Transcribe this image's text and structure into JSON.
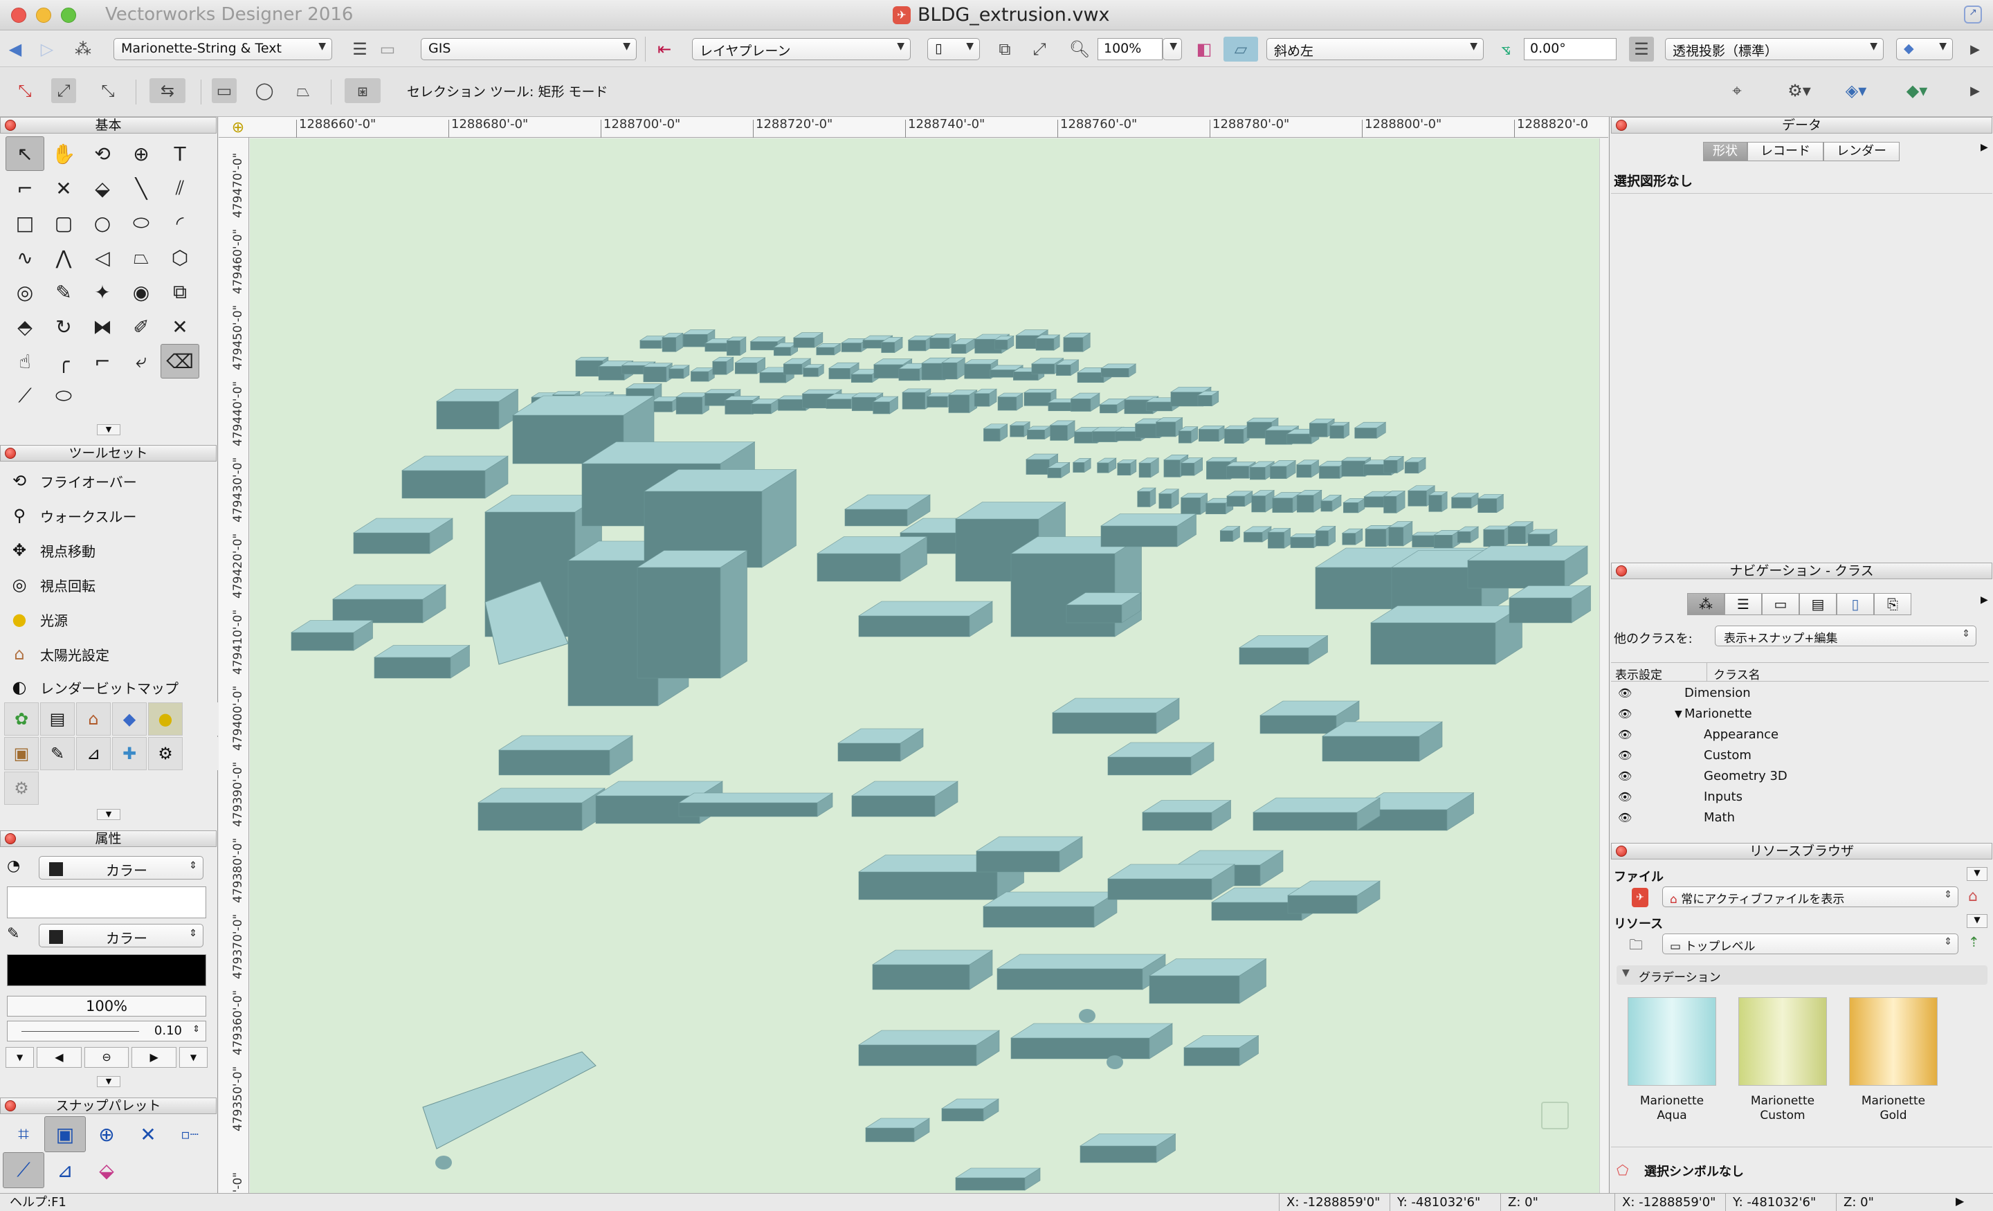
{
  "window": {
    "app_name": "Vectorworks Designer 2016",
    "doc_title": "BLDG_extrusion.vwx"
  },
  "toolbar1": {
    "class_dropdown": "Marionette-String & Text",
    "layer_dropdown": "GIS",
    "plane_dropdown": "レイヤプレーン",
    "zoom": "100%",
    "view_dropdown": "斜め左",
    "angle": "0.00°",
    "projection_dropdown": "透視投影（標準）"
  },
  "toolbar2": {
    "mode_text": "セレクション ツール: 矩形 モード"
  },
  "basic_palette": {
    "title": "基本"
  },
  "toolsets": {
    "title": "ツールセット",
    "items": [
      {
        "label": "フライオーバー",
        "icon": "flyover-icon"
      },
      {
        "label": "ウォークスルー",
        "icon": "walkthrough-icon"
      },
      {
        "label": "視点移動",
        "icon": "translate-view-icon"
      },
      {
        "label": "視点回転",
        "icon": "rotate-view-icon"
      },
      {
        "label": "光源",
        "icon": "light-icon"
      },
      {
        "label": "太陽光設定",
        "icon": "sun-icon"
      },
      {
        "label": "レンダービットマップ",
        "icon": "render-bitmap-icon"
      }
    ]
  },
  "attributes": {
    "title": "属性",
    "fill_mode": "カラー",
    "pen_mode": "カラー",
    "opacity": "100%",
    "line_weight": "0.10"
  },
  "snap": {
    "title": "スナップパレット"
  },
  "ruler": {
    "h_ticks": [
      "1288660'-0\"",
      "1288680'-0\"",
      "1288700'-0\"",
      "1288720'-0\"",
      "1288740'-0\"",
      "1288760'-0\"",
      "1288780'-0\"",
      "1288800'-0\"",
      "1288820'-0"
    ],
    "v_ticks": [
      "479470'-0\"",
      "479460'-0\"",
      "479450'-0\"",
      "479440'-0\"",
      "479430'-0\"",
      "479420'-0\"",
      "479410'-0\"",
      "479400'-0\"",
      "479390'-0\"",
      "479380'-0\"",
      "479370'-0\"",
      "479360'-0\"",
      "479350'-0\"",
      "40'-0\""
    ]
  },
  "data_palette": {
    "title": "データ",
    "tabs": [
      "形状",
      "レコード",
      "レンダー"
    ],
    "active_tab": 0,
    "empty_text": "選択図形なし"
  },
  "navigation": {
    "title": "ナビゲーション - クラス",
    "other_classes_label": "他のクラスを:",
    "other_classes_value": "表示+スナップ+編集",
    "col_visibility": "表示設定",
    "col_name": "クラス名",
    "rows": [
      {
        "name": "Dimension",
        "indent": 0,
        "expander": ""
      },
      {
        "name": "Marionette",
        "indent": 0,
        "expander": "▼"
      },
      {
        "name": "Appearance",
        "indent": 1,
        "expander": ""
      },
      {
        "name": "Custom",
        "indent": 1,
        "expander": ""
      },
      {
        "name": "Geometry 3D",
        "indent": 1,
        "expander": ""
      },
      {
        "name": "Inputs",
        "indent": 1,
        "expander": ""
      },
      {
        "name": "Math",
        "indent": 1,
        "expander": ""
      }
    ]
  },
  "resources": {
    "title": "リソースブラウザ",
    "file_label": "ファイル",
    "file_value": "常にアクティブファイルを表示",
    "resource_label": "リソース",
    "resource_value": "トップレベル",
    "section": "グラデーション",
    "gradients": [
      {
        "line1": "Marionette",
        "line2": "Aqua",
        "colors": [
          "#9fd9dc",
          "#e3f7f7",
          "#9fd9dc"
        ]
      },
      {
        "line1": "Marionette",
        "line2": "Custom",
        "colors": [
          "#cdd77f",
          "#f2f4d2",
          "#c8cf7c"
        ]
      },
      {
        "line1": "Marionette",
        "line2": "Gold",
        "colors": [
          "#e6b143",
          "#fff0c8",
          "#e3ad3e"
        ]
      }
    ],
    "footer": "選択シンボルなし"
  },
  "status": {
    "help": "ヘルプ:F1",
    "x1": "X:  -1288859'0\"",
    "y1": "Y:  -481032'6\"",
    "z1": "Z:  0\"",
    "x2": "X:  -1288859'0\"",
    "y2": "Y:  -481032'6\"",
    "z2": "Z:  0\""
  },
  "colors": {
    "viewport_bg": "#d9ecd6",
    "building_top": "#a9d2d3",
    "building_side": "#7fa9aa",
    "building_dark": "#5f8889"
  }
}
